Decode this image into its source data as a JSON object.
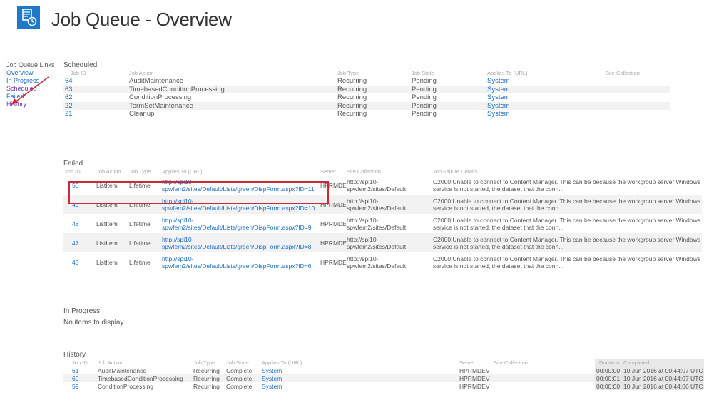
{
  "header": {
    "title": "Job Queue - Overview",
    "logo_icon": "job-queue-icon",
    "logo_color": "#1f78c8"
  },
  "nav": {
    "heading": "Job Queue Links",
    "items": [
      {
        "label": "Overview"
      },
      {
        "label": "In Progress"
      },
      {
        "label": "Scheduled"
      },
      {
        "label": "Failed"
      },
      {
        "label": "History"
      }
    ]
  },
  "highlight_color": "#cc2a3a",
  "link_color": "#1a6fc4",
  "scheduled": {
    "title": "Scheduled",
    "headers": [
      "Job ID",
      "Job Action",
      "Job Type",
      "Job State",
      "Applies To (URL)",
      "Site Collection"
    ],
    "rows": [
      {
        "id": "64",
        "action": "AuditMaintenance",
        "type": "Recurring",
        "state": "Pending",
        "applies": "System",
        "site": ""
      },
      {
        "id": "63",
        "action": "TimebasedConditionProcessing",
        "type": "Recurring",
        "state": "Pending",
        "applies": "System",
        "site": ""
      },
      {
        "id": "62",
        "action": "ConditionProcessing",
        "type": "Recurring",
        "state": "Pending",
        "applies": "System",
        "site": ""
      },
      {
        "id": "22",
        "action": "TermSetMaintenance",
        "type": "Recurring",
        "state": "Pending",
        "applies": "System",
        "site": ""
      },
      {
        "id": "21",
        "action": "Cleanup",
        "type": "Recurring",
        "state": "Pending",
        "applies": "System",
        "site": ""
      }
    ]
  },
  "failed": {
    "title": "Failed",
    "headers": [
      "Job ID",
      "Job Action",
      "Job Type",
      "Applies To (URL)",
      "Server",
      "Site Collection",
      "Job Failure Details"
    ],
    "rows": [
      {
        "id": "50",
        "action": "ListItem",
        "type": "Lifetime",
        "applies": "http://spi10-spwfem2/sites/Default/Lists/green/DispForm.aspx?ID=11",
        "server": "HPRMDEV",
        "site": "http://spi10-spwfem2/sites/Default",
        "details": "C2000:Unable to connect to Content Manager. This can be because the workgroup server Windows service is not started, the dataset that the conn..."
      },
      {
        "id": "49",
        "action": "ListItem",
        "type": "Lifetime",
        "applies": "http://spi10-spwfem2/sites/Default/Lists/green/DispForm.aspx?ID=10",
        "server": "HPRMDEV",
        "site": "http://spi10-spwfem2/sites/Default",
        "details": "C2000:Unable to connect to Content Manager. This can be because the workgroup server Windows service is not started, the dataset that the conn..."
      },
      {
        "id": "48",
        "action": "ListItem",
        "type": "Lifetime",
        "applies": "http://spi10-spwfem2/sites/Default/Lists/green/DispForm.aspx?ID=9",
        "server": "HPRMDEV",
        "site": "http://spi10-spwfem2/sites/Default",
        "details": "C2000:Unable to connect to Content Manager. This can be because the workgroup server Windows service is not started, the dataset that the conn..."
      },
      {
        "id": "47",
        "action": "ListItem",
        "type": "Lifetime",
        "applies": "http://spi10-spwfem2/sites/Default/Lists/green/DispForm.aspx?ID=8",
        "server": "HPRMDEV",
        "site": "http://spi10-spwfem2/sites/Default",
        "details": "C2000:Unable to connect to Content Manager. This can be because the workgroup server Windows service is not started, the dataset that the conn..."
      },
      {
        "id": "45",
        "action": "ListItem",
        "type": "Lifetime",
        "applies": "http://spi10-spwfem2/sites/Default/Lists/green/DispForm.aspx?ID=6",
        "server": "HPRMDEV",
        "site": "http://spi10-spwfem2/sites/Default",
        "details": "C2000:Unable to connect to Content Manager. This can be because the workgroup server Windows service is not started, the dataset that the conn..."
      }
    ]
  },
  "in_progress": {
    "title": "In Progress",
    "empty_text": "No items to display"
  },
  "history": {
    "title": "History",
    "headers": [
      "Job ID",
      "Job Action",
      "Job Type",
      "Job State",
      "Applies To (URL)",
      "Server",
      "Site Collection",
      "Duration",
      "Completed"
    ],
    "rows": [
      {
        "id": "61",
        "action": "AuditMaintenance",
        "type": "Recurring",
        "state": "Complete",
        "applies": "System",
        "server": "HPRMDEV",
        "site": "",
        "duration": "00:00:00",
        "completed": "10 Jun 2016 at 00:44:07 UTC"
      },
      {
        "id": "60",
        "action": "TimebasedConditionProcessing",
        "type": "Recurring",
        "state": "Complete",
        "applies": "System",
        "server": "HPRMDEV",
        "site": "",
        "duration": "00:00:01",
        "completed": "10 Jun 2016 at 00:44:07 UTC"
      },
      {
        "id": "59",
        "action": "ConditionProcessing",
        "type": "Recurring",
        "state": "Complete",
        "applies": "System",
        "server": "HPRMDEV",
        "site": "",
        "duration": "00:00:00",
        "completed": "10 Jun 2016 at 00:44:06 UTC"
      }
    ]
  }
}
